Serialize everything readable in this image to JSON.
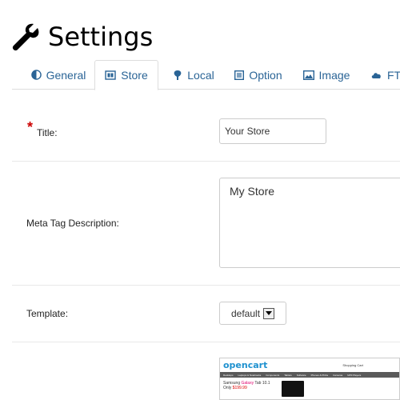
{
  "header": {
    "title": "Settings",
    "icon": "wrench-icon"
  },
  "tabs": [
    {
      "label": "General",
      "icon": "contrast-icon",
      "active": false
    },
    {
      "label": "Store",
      "icon": "store-icon",
      "active": true
    },
    {
      "label": "Local",
      "icon": "flag-icon",
      "active": false
    },
    {
      "label": "Option",
      "icon": "list-icon",
      "active": false
    },
    {
      "label": "Image",
      "icon": "image-icon",
      "active": false
    },
    {
      "label": "FTP",
      "icon": "cloud-icon",
      "active": false
    }
  ],
  "form": {
    "title": {
      "label": "Title:",
      "required": "*",
      "value": "Your Store"
    },
    "meta_description": {
      "label": "Meta Tag Description:",
      "value": "My Store"
    },
    "template": {
      "label": "Template:",
      "value": "default"
    }
  },
  "preview": {
    "logo": "opencart",
    "cart": "Shopping Cart",
    "nav": [
      "Desktops",
      "Laptops & Notebooks",
      "Components",
      "Tablets",
      "Software",
      "Phones & PDAs",
      "Cameras",
      "MP3 Players"
    ],
    "banner_line1": "Samsung",
    "banner_highlight": "Galaxy",
    "banner_line1_end": "Tab 10.1",
    "banner_only": "Only",
    "banner_price": "$199.99"
  },
  "colors": {
    "accent": "#2a6496",
    "required": "#cc0000",
    "border": "#dddddd"
  }
}
